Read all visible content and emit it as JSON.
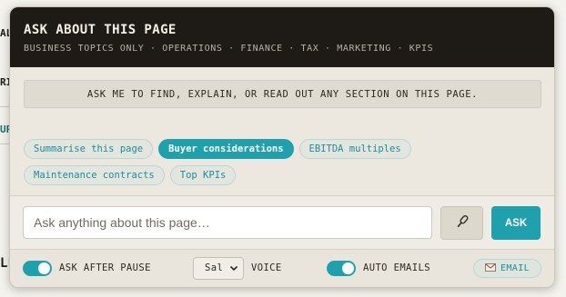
{
  "background": {
    "fragments": [
      "AL",
      "RI",
      "UP",
      "LL"
    ]
  },
  "panel": {
    "title": "ASK ABOUT THIS PAGE",
    "subtitle": "BUSINESS TOPICS ONLY · OPERATIONS · FINANCE · TAX · MARKETING · KPIS",
    "info": "ASK ME TO FIND, EXPLAIN, OR READ OUT ANY SECTION ON THIS PAGE.",
    "chips": [
      {
        "label": "Summarise this page",
        "active": false
      },
      {
        "label": "Buyer considerations",
        "active": true
      },
      {
        "label": "EBITDA multiples",
        "active": false
      },
      {
        "label": "Maintenance contracts",
        "active": false
      },
      {
        "label": "Top KPIs",
        "active": false
      }
    ],
    "input": {
      "placeholder": "Ask anything about this page…",
      "value": ""
    },
    "ask_label": "ASK",
    "mic_icon": "microphone-icon",
    "footer": {
      "ask_after_pause_label": "ASK AFTER PAUSE",
      "ask_after_pause_on": true,
      "voice_select_value": "Sal",
      "voice_label": "VOICE",
      "auto_emails_label": "AUTO EMAILS",
      "auto_emails_on": true,
      "email_label": "EMAIL",
      "email_icon": "envelope-icon"
    }
  },
  "colors": {
    "accent": "#1fa0ad",
    "header_bg": "#1e1a16",
    "panel_bg": "#ece8df"
  }
}
